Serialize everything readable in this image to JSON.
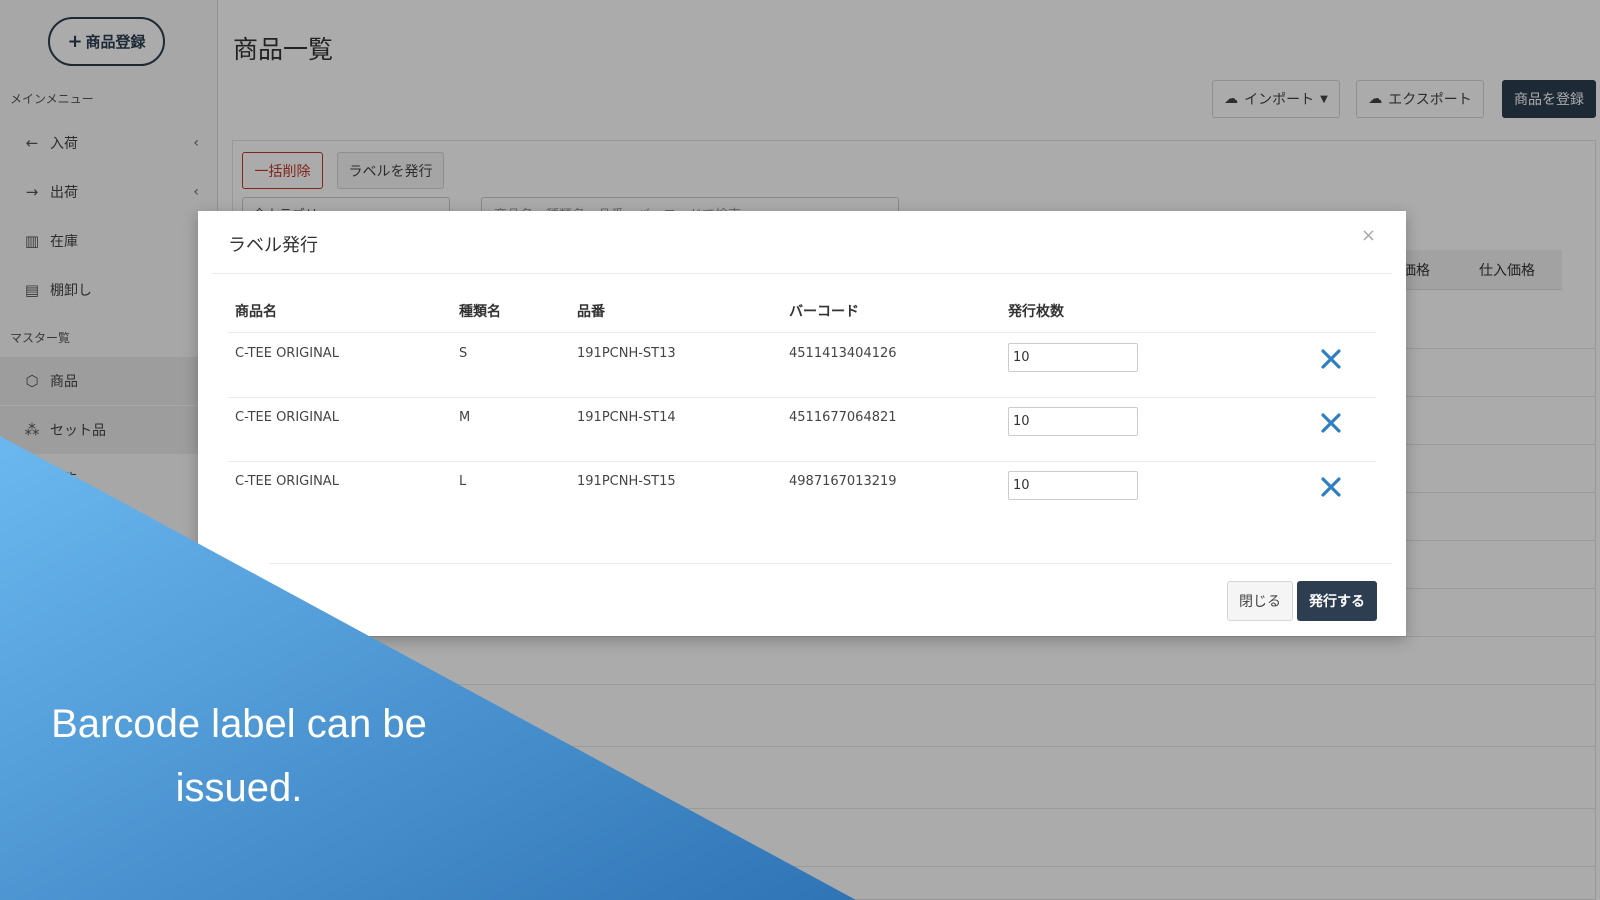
{
  "sidebar": {
    "register_button": "商品登録",
    "main_menu_label": "メインメニュー",
    "master_label": "マスター覧",
    "items": [
      {
        "label": "入荷",
        "icon": "arrow-left-icon"
      },
      {
        "label": "出荷",
        "icon": "arrow-right-icon"
      },
      {
        "label": "在庫",
        "icon": "warehouse-icon"
      },
      {
        "label": "棚卸し",
        "icon": "clipboard-icon"
      },
      {
        "label": "商品",
        "icon": "box-icon"
      },
      {
        "label": "セット品",
        "icon": "boxes-icon"
      },
      {
        "label": "…先",
        "icon": "list-icon"
      }
    ]
  },
  "main": {
    "title": "商品一覧",
    "import_label": "インポート",
    "export_label": "エクスポート",
    "register_label": "商品を登録",
    "bulk_delete_label": "一括削除",
    "issue_label_label": "ラベルを発行",
    "filter_value": "全カテゴリ",
    "search_placeholder": "商品名・種類名・品番・バーコードで検索",
    "visible_columns": [
      "価格",
      "仕入価格"
    ]
  },
  "modal": {
    "title": "ラベル発行",
    "close_symbol": "×",
    "columns": [
      "商品名",
      "種類名",
      "品番",
      "バーコード",
      "発行枚数"
    ],
    "rows": [
      {
        "name": "C-TEE ORIGINAL",
        "variant": "S",
        "sku": "191PCNH-ST13",
        "barcode": "4511413404126",
        "qty": "10"
      },
      {
        "name": "C-TEE ORIGINAL",
        "variant": "M",
        "sku": "191PCNH-ST14",
        "barcode": "4511677064821",
        "qty": "10"
      },
      {
        "name": "C-TEE ORIGINAL",
        "variant": "L",
        "sku": "191PCNH-ST15",
        "barcode": "4987167013219",
        "qty": "10"
      }
    ],
    "close_label": "閉じる",
    "issue_label": "発行する"
  },
  "caption": {
    "line1": "Barcode label can be",
    "line2": "issued."
  },
  "colors": {
    "navy": "#2c3e50",
    "danger": "#c0392b",
    "delete_x": "#2f7fc1",
    "caption_blue_light": "#6bb8f0",
    "caption_blue_dark": "#2f74b5"
  }
}
